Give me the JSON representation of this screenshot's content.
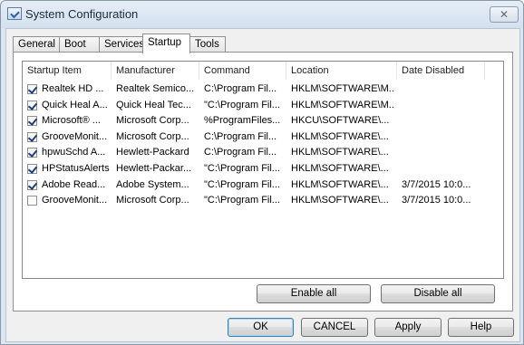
{
  "window": {
    "title": "System Configuration",
    "close_glyph": "✕"
  },
  "tabs": [
    {
      "label": "General",
      "active": false
    },
    {
      "label": "Boot",
      "active": false
    },
    {
      "label": "Services",
      "active": false
    },
    {
      "label": "Startup",
      "active": true
    },
    {
      "label": "Tools",
      "active": false
    }
  ],
  "startup": {
    "columns": [
      "Startup Item",
      "Manufacturer",
      "Command",
      "Location",
      "Date Disabled"
    ],
    "rows": [
      {
        "checked": true,
        "item": "Realtek HD ...",
        "manufacturer": "Realtek Semico...",
        "command": "C:\\Program Fil...",
        "location": "HKLM\\SOFTWARE\\M...",
        "date": ""
      },
      {
        "checked": true,
        "item": "Quick Heal A...",
        "manufacturer": "Quick Heal Tec...",
        "command": "\"C:\\Program Fil...",
        "location": "HKLM\\SOFTWARE\\M...",
        "date": ""
      },
      {
        "checked": true,
        "item": "Microsoft® ...",
        "manufacturer": "Microsoft Corp...",
        "command": "%ProgramFiles...",
        "location": "HKCU\\SOFTWARE\\...",
        "date": ""
      },
      {
        "checked": true,
        "item": "GrooveMonit...",
        "manufacturer": "Microsoft Corp...",
        "command": "C:\\Program Fil...",
        "location": "HKLM\\SOFTWARE\\...",
        "date": ""
      },
      {
        "checked": true,
        "item": "hpwuSchd A...",
        "manufacturer": "Hewlett-Packard",
        "command": "C:\\Program Fil...",
        "location": "HKLM\\SOFTWARE\\...",
        "date": ""
      },
      {
        "checked": true,
        "item": "HPStatusAlerts",
        "manufacturer": "Hewlett-Packar...",
        "command": "\"C:\\Program Fil...",
        "location": "HKLM\\SOFTWARE\\...",
        "date": ""
      },
      {
        "checked": true,
        "item": "Adobe Read...",
        "manufacturer": "Adobe System...",
        "command": "\"C:\\Program Fil...",
        "location": "HKLM\\SOFTWARE\\...",
        "date": "3/7/2015 10:0..."
      },
      {
        "checked": false,
        "item": "GrooveMonit...",
        "manufacturer": "Microsoft Corp...",
        "command": "\"C:\\Program Fil...",
        "location": "HKLM\\SOFTWARE\\...",
        "date": "3/7/2015 10:0..."
      }
    ],
    "enable_all_label": "Enable all",
    "disable_all_label": "Disable all"
  },
  "buttons": {
    "ok": "OK",
    "cancel": "CANCEL",
    "apply": "Apply",
    "help": "Help"
  },
  "colors": {
    "title_bar": "#d3e0ee",
    "default_button_border": "#3c7fb1",
    "check_mark": "#1a3f7a"
  }
}
